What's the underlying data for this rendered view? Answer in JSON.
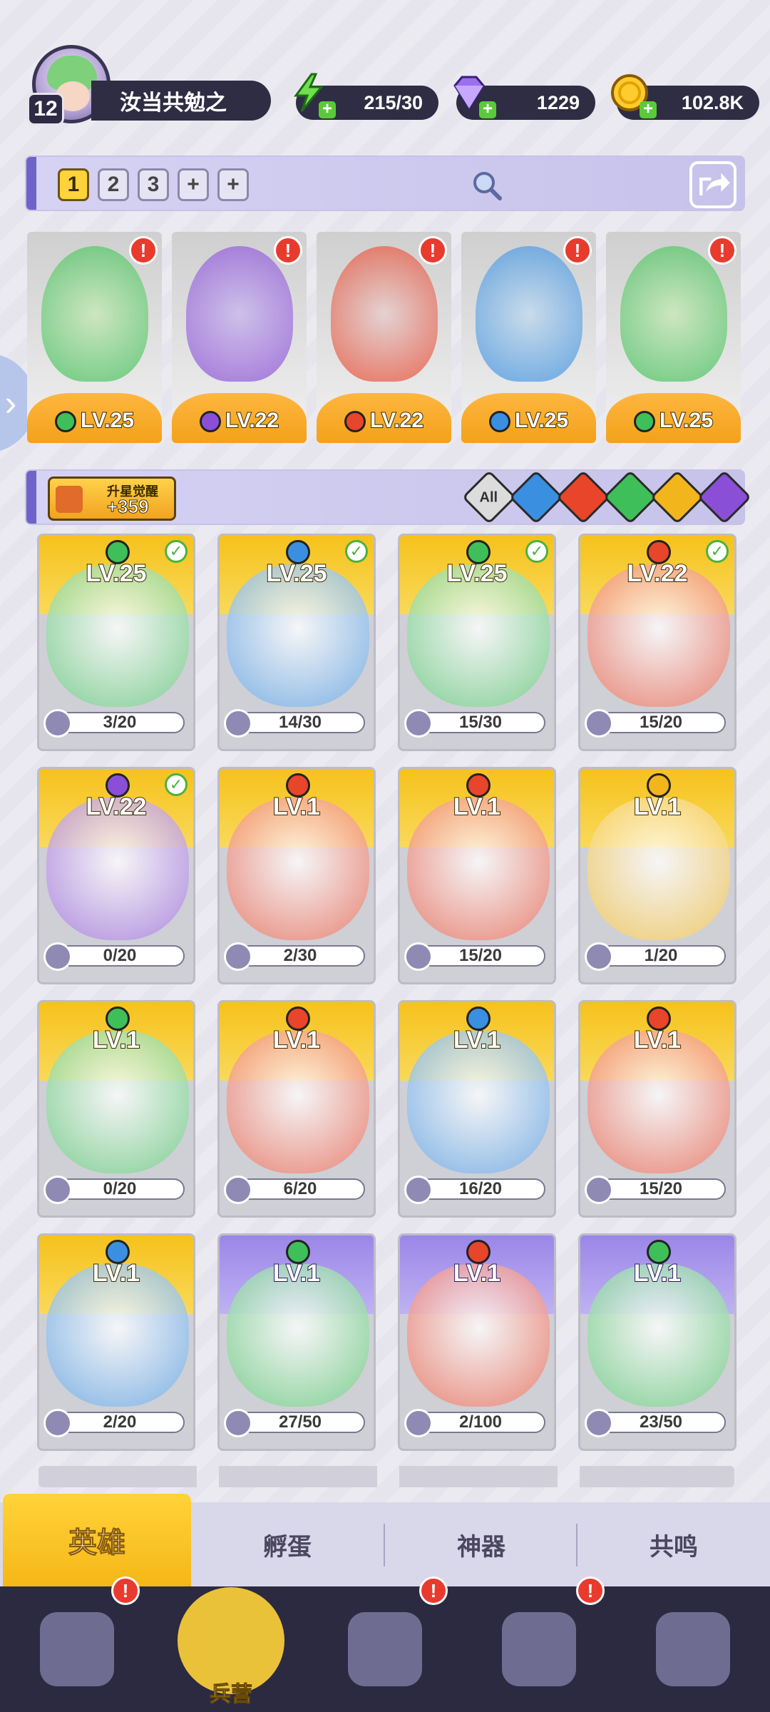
{
  "player": {
    "level": "12",
    "name": "汝当共勉之"
  },
  "resources": {
    "energy": "215/30",
    "gems": "1229",
    "coins": "102.8K"
  },
  "teams": [
    "1",
    "2",
    "3",
    "+",
    "+"
  ],
  "lineup": [
    {
      "level": "LV.25",
      "element": "wind"
    },
    {
      "level": "LV.22",
      "element": "dark"
    },
    {
      "level": "LV.22",
      "element": "fire"
    },
    {
      "level": "LV.25",
      "element": "water"
    },
    {
      "level": "LV.25",
      "element": "wind"
    }
  ],
  "star_awaken": {
    "label": "升星觉醒",
    "value": "+359"
  },
  "filters": [
    "All",
    "water",
    "fire",
    "wind",
    "light",
    "dark"
  ],
  "heroes": [
    {
      "level": "LV.25",
      "progress": "3/20",
      "element": "wind",
      "checked": true,
      "tier": "gold"
    },
    {
      "level": "LV.25",
      "progress": "14/30",
      "element": "water",
      "checked": true,
      "tier": "gold"
    },
    {
      "level": "LV.25",
      "progress": "15/30",
      "element": "wind",
      "checked": true,
      "tier": "gold"
    },
    {
      "level": "LV.22",
      "progress": "15/20",
      "element": "fire",
      "checked": true,
      "tier": "gold"
    },
    {
      "level": "LV.22",
      "progress": "0/20",
      "element": "dark",
      "checked": true,
      "tier": "gold"
    },
    {
      "level": "LV.1",
      "progress": "2/30",
      "element": "fire",
      "checked": false,
      "tier": "gold"
    },
    {
      "level": "LV.1",
      "progress": "15/20",
      "element": "fire",
      "checked": false,
      "tier": "gold"
    },
    {
      "level": "LV.1",
      "progress": "1/20",
      "element": "light",
      "checked": false,
      "tier": "gold"
    },
    {
      "level": "LV.1",
      "progress": "0/20",
      "element": "wind",
      "checked": false,
      "tier": "gold"
    },
    {
      "level": "LV.1",
      "progress": "6/20",
      "element": "fire",
      "checked": false,
      "tier": "gold"
    },
    {
      "level": "LV.1",
      "progress": "16/20",
      "element": "water",
      "checked": false,
      "tier": "gold"
    },
    {
      "level": "LV.1",
      "progress": "15/20",
      "element": "fire",
      "checked": false,
      "tier": "gold"
    },
    {
      "level": "LV.1",
      "progress": "2/20",
      "element": "water",
      "checked": false,
      "tier": "gold"
    },
    {
      "level": "LV.1",
      "progress": "27/50",
      "element": "wind",
      "checked": false,
      "tier": "purple"
    },
    {
      "level": "LV.1",
      "progress": "2/100",
      "element": "fire",
      "checked": false,
      "tier": "purple"
    },
    {
      "level": "LV.1",
      "progress": "23/50",
      "element": "wind",
      "checked": false,
      "tier": "purple"
    }
  ],
  "subtabs": [
    "英雄",
    "孵蛋",
    "神器",
    "共鸣"
  ],
  "nav": {
    "active_label": "兵营"
  },
  "colors": {
    "wind": "#3fbf5a",
    "water": "#3a8fe0",
    "fire": "#e8452a",
    "dark": "#8a4fd6",
    "light": "#f2b61c",
    "accent": "#ffd33a"
  }
}
